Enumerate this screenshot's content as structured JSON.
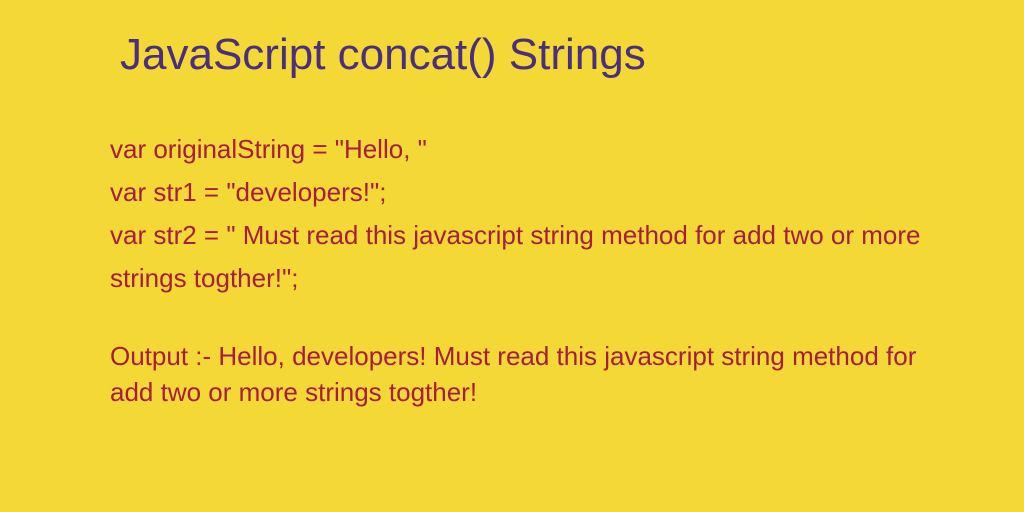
{
  "title": "JavaScript concat() Strings",
  "code": {
    "line1": "var originalString = \"Hello, \"",
    "line2": "var str1 = \"developers!\";",
    "line3": "var str2 = \" Must read this javascript string method for add two or more strings togther!\";"
  },
  "output": "Output :- Hello, developers! Must read this javascript string method for add two or more strings togther!"
}
